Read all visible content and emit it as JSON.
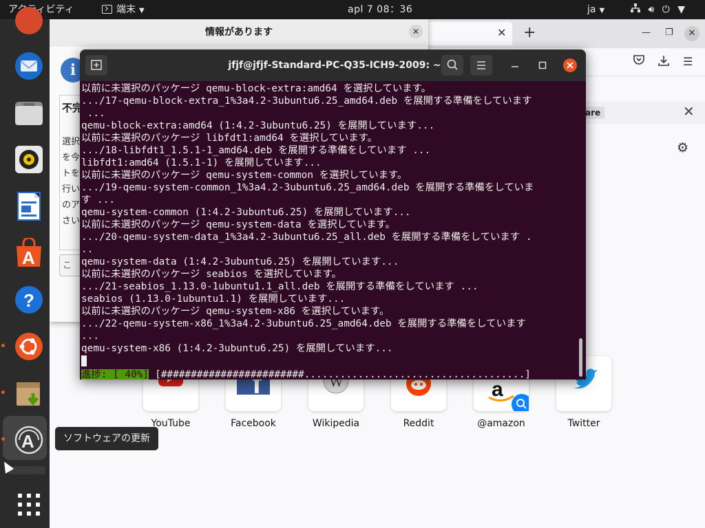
{
  "topbar": {
    "activities": "アクティビティ",
    "app_menu": "端末",
    "clock": "apl 7 08：36",
    "lang": "ja"
  },
  "dock": {
    "tooltip": "ソフトウェアの更新",
    "items": [
      "ubuntu-top-icon",
      "thunderbird",
      "files",
      "rhythmbox",
      "libreoffice-writer",
      "ubuntu-software",
      "help",
      "ubuntu-software-updater-active",
      "archive-installer",
      "software-updater",
      "show-applications"
    ]
  },
  "dialog": {
    "title": "情報があります",
    "heading": "不完",
    "lines": [
      "選択",
      "を今",
      "トを",
      "行い",
      "のア",
      "さい"
    ],
    "button": "こ"
  },
  "firefox": {
    "notification_button": "are",
    "shortcuts": [
      "YouTube",
      "Facebook",
      "Wikipedia",
      "Reddit",
      "@amazon",
      "Twitter"
    ]
  },
  "terminal": {
    "title": "jfjf@jfjf-Standard-PC-Q35-ICH9-2009: ~",
    "lines": [
      "以前に未選択のパッケージ qemu-block-extra:amd64 を選択しています。",
      ".../17-qemu-block-extra_1%3a4.2-3ubuntu6.25_amd64.deb を展開する準備をしています",
      " ...",
      "qemu-block-extra:amd64 (1:4.2-3ubuntu6.25) を展開しています...",
      "以前に未選択のパッケージ libfdt1:amd64 を選択しています。",
      ".../18-libfdt1_1.5.1-1_amd64.deb を展開する準備をしています ...",
      "libfdt1:amd64 (1.5.1-1) を展開しています...",
      "以前に未選択のパッケージ qemu-system-common を選択しています。",
      ".../19-qemu-system-common_1%3a4.2-3ubuntu6.25_amd64.deb を展開する準備をしていま",
      "す ...",
      "qemu-system-common (1:4.2-3ubuntu6.25) を展開しています...",
      "以前に未選択のパッケージ qemu-system-data を選択しています。",
      ".../20-qemu-system-data_1%3a4.2-3ubuntu6.25_all.deb を展開する準備をしています .",
      "..",
      "qemu-system-data (1:4.2-3ubuntu6.25) を展開しています...",
      "以前に未選択のパッケージ seabios を選択しています。",
      ".../21-seabios_1.13.0-1ubuntu1.1_all.deb を展開する準備をしています ...",
      "seabios (1.13.0-1ubuntu1.1) を展開しています...",
      "以前に未選択のパッケージ qemu-system-x86 を選択しています。",
      ".../22-qemu-system-x86_1%3a4.2-3ubuntu6.25_amd64.deb を展開する準備をしています",
      "...",
      "qemu-system-x86 (1:4.2-3ubuntu6.25) を展開しています..."
    ],
    "progress_label": "進捗: [ 40%]",
    "progress_bar": "[########################.....................................]",
    "progress_percent": 40
  },
  "colors": {
    "terminal_bg": "#300a24",
    "progress_green": "#4e9a06",
    "ubuntu_orange": "#e95420"
  }
}
